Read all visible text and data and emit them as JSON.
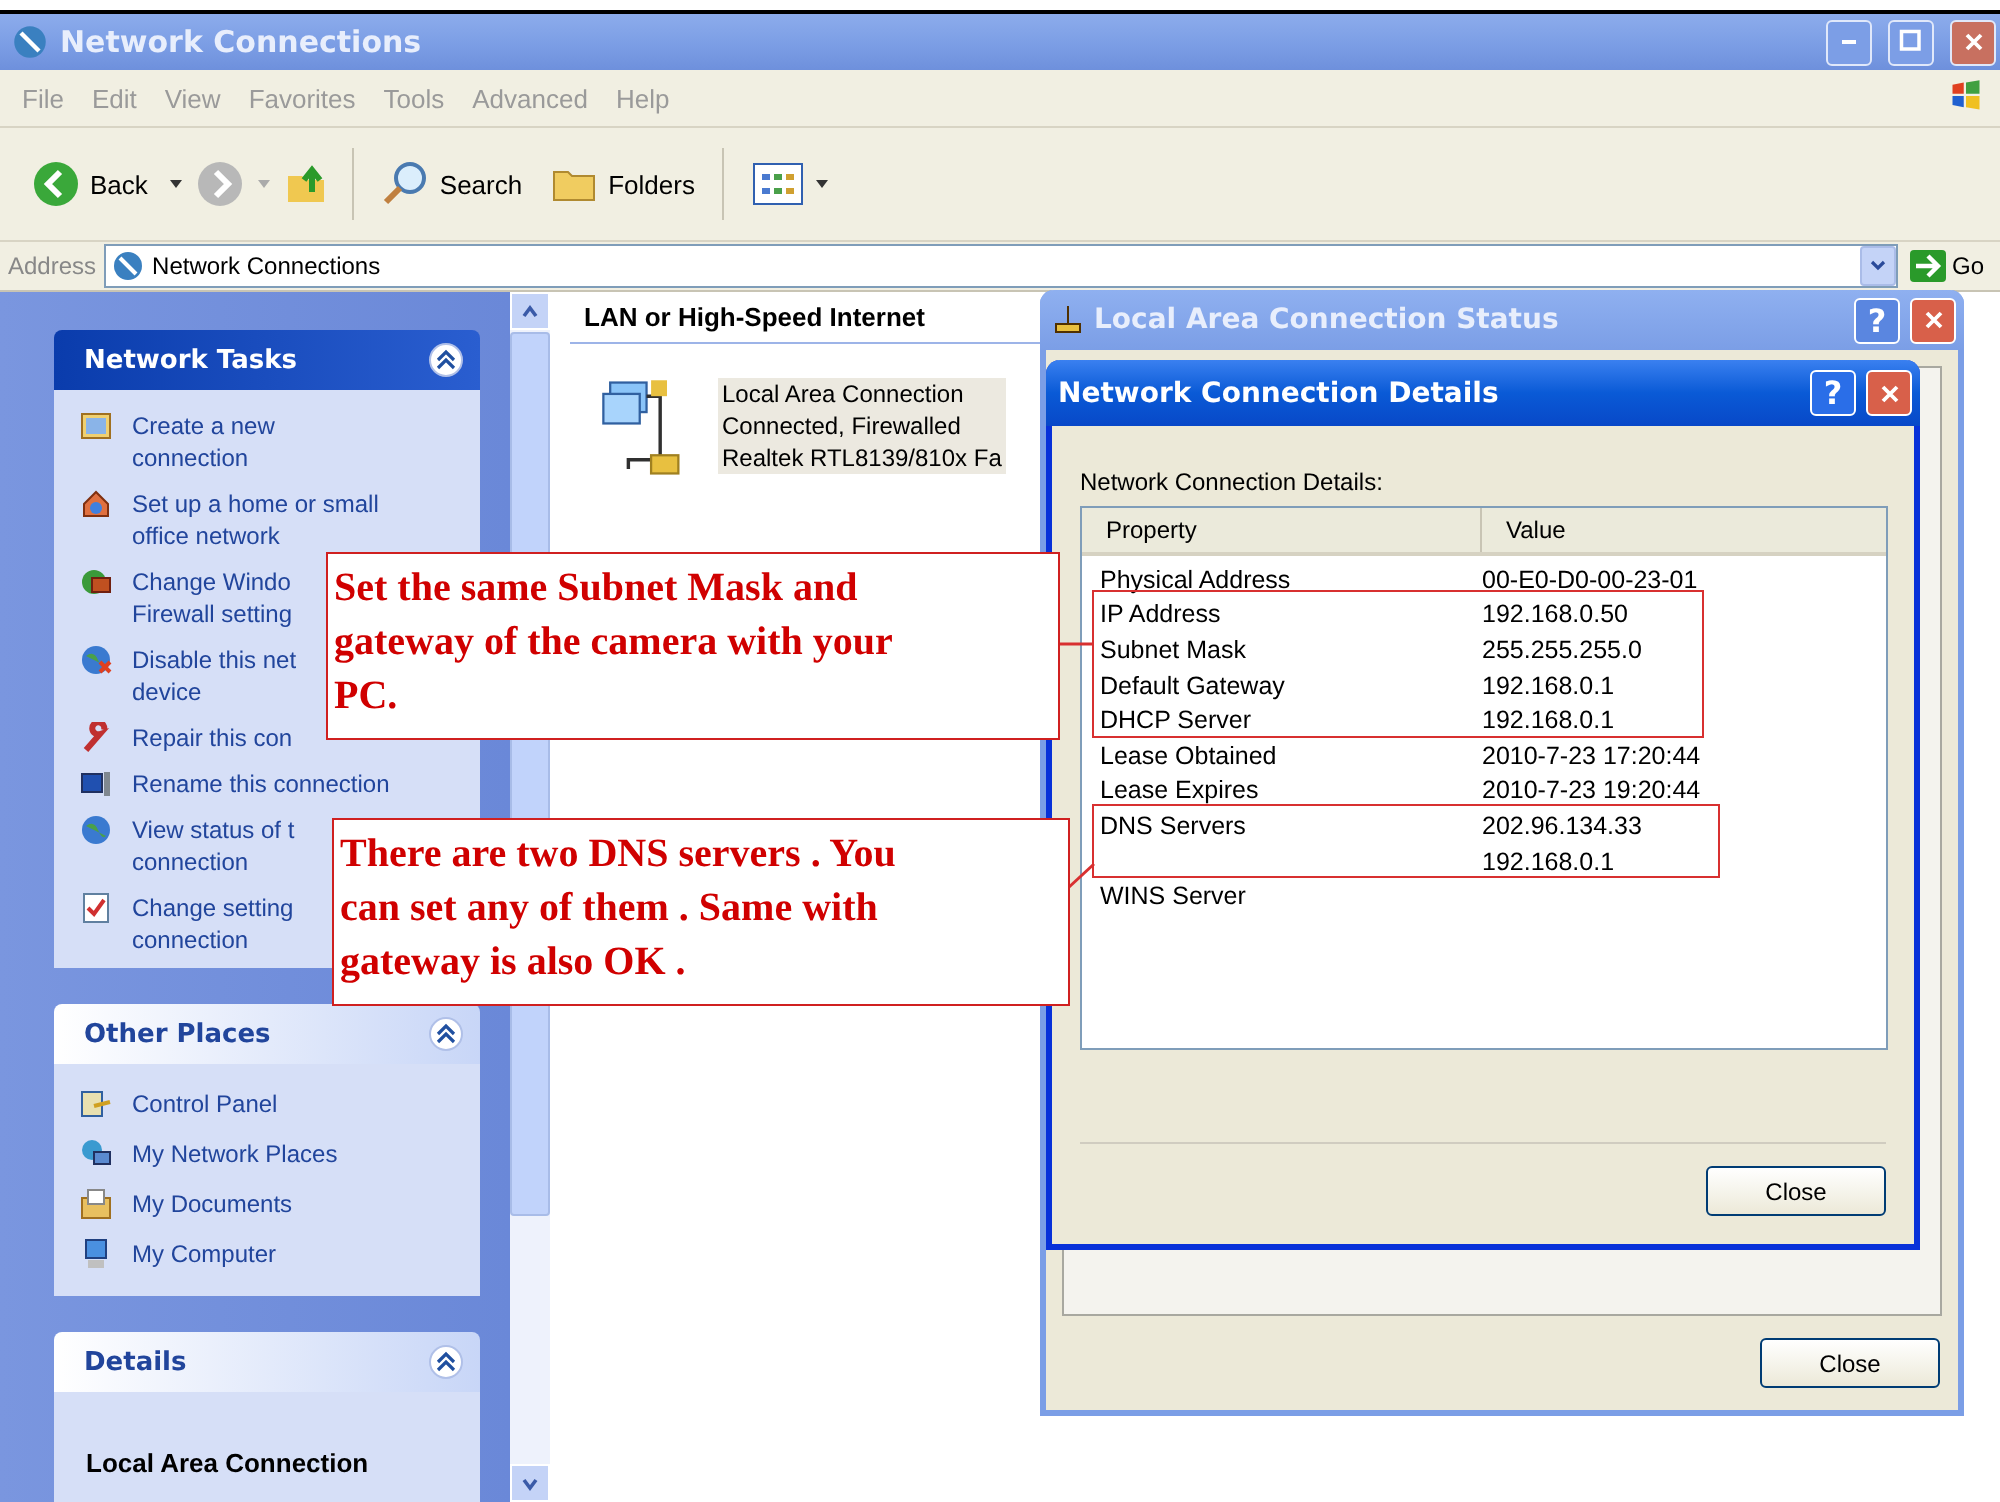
{
  "window": {
    "title": "Network Connections"
  },
  "menu": [
    "File",
    "Edit",
    "View",
    "Favorites",
    "Tools",
    "Advanced",
    "Help"
  ],
  "toolbar": {
    "back": "Back",
    "search": "Search",
    "folders": "Folders"
  },
  "address": {
    "label": "Address",
    "value": "Network Connections",
    "go": "Go"
  },
  "sidebar": {
    "panels": [
      {
        "kind": "tasks",
        "title": "Network Tasks",
        "items": [
          {
            "lines": [
              "Create a new",
              "connection"
            ]
          },
          {
            "lines": [
              "Set up a home or small",
              "office network"
            ]
          },
          {
            "lines": [
              "Change Windo",
              "Firewall setting"
            ]
          },
          {
            "lines": [
              "Disable this net",
              "device"
            ]
          },
          {
            "lines": [
              "Repair this con"
            ]
          },
          {
            "lines": [
              "Rename this connection"
            ]
          },
          {
            "lines": [
              "View status of t",
              "connection"
            ]
          },
          {
            "lines": [
              "Change setting",
              "connection"
            ]
          }
        ]
      },
      {
        "kind": "places",
        "title": "Other Places",
        "items": [
          {
            "lines": [
              "Control Panel"
            ]
          },
          {
            "lines": [
              "My Network Places"
            ]
          },
          {
            "lines": [
              "My Documents"
            ]
          },
          {
            "lines": [
              "My Computer"
            ]
          }
        ]
      },
      {
        "kind": "details",
        "title": "Details",
        "heading": "Local Area Connection"
      }
    ]
  },
  "content": {
    "group": "LAN or High-Speed Internet",
    "connections": [
      {
        "selected": true,
        "lines": [
          "Local Area Connection",
          "Connected, Firewalled",
          "Realtek RTL8139/810x Fa"
        ]
      }
    ]
  },
  "status_dialog": {
    "title": "Local Area Connection Status",
    "help": "?",
    "close": "Close"
  },
  "details_dialog": {
    "title": "Network Connection Details",
    "help": "?",
    "label": "Network Connection Details:",
    "columns": [
      "Property",
      "Value"
    ],
    "rows": [
      {
        "property": "Physical Address",
        "value": "00-E0-D0-00-23-01"
      },
      {
        "property": "IP Address",
        "value": "192.168.0.50"
      },
      {
        "property": "Subnet Mask",
        "value": "255.255.255.0"
      },
      {
        "property": "Default Gateway",
        "value": "192.168.0.1"
      },
      {
        "property": "DHCP Server",
        "value": "192.168.0.1"
      },
      {
        "property": "Lease Obtained",
        "value": "2010-7-23 17:20:44"
      },
      {
        "property": "Lease Expires",
        "value": "2010-7-23 19:20:44"
      },
      {
        "property": "DNS Servers",
        "value": "202.96.134.33"
      },
      {
        "value": "192.168.0.1"
      },
      {
        "property": "WINS Server"
      }
    ],
    "close": "Close"
  },
  "annotations": [
    {
      "lines": [
        "Set the same Subnet Mask and",
        "gateway of the camera with your",
        "PC."
      ]
    },
    {
      "lines": [
        "There are two DNS servers . You",
        "can set any of them . Same with",
        "gateway is also OK ."
      ]
    }
  ]
}
